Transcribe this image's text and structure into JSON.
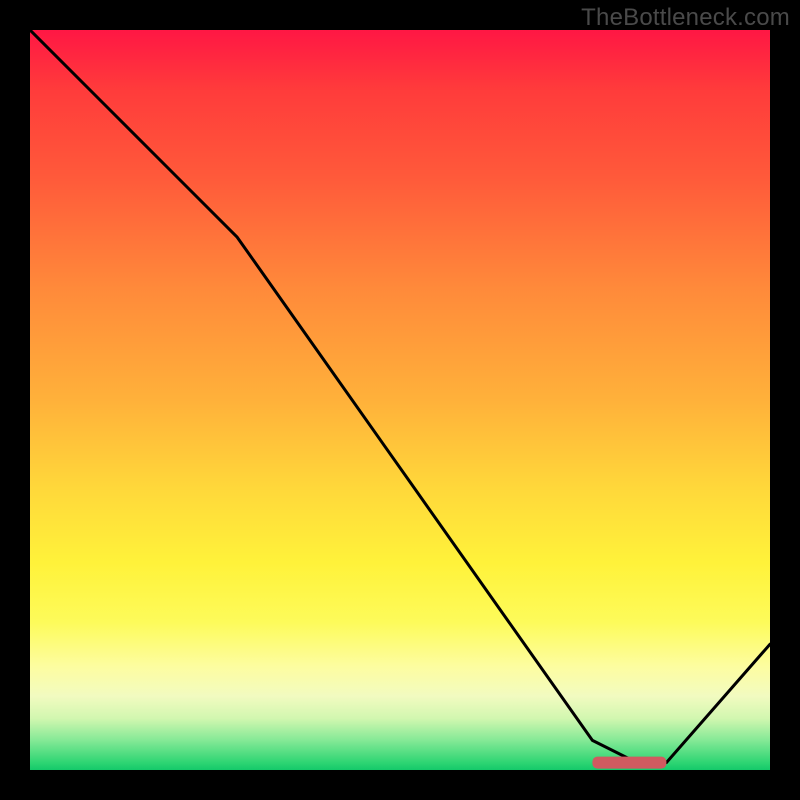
{
  "watermark": "TheBottleneck.com",
  "chart_data": {
    "type": "line",
    "title": "",
    "xlabel": "",
    "ylabel": "",
    "xlim": [
      0,
      100
    ],
    "ylim": [
      0,
      100
    ],
    "x": [
      0,
      10,
      20,
      28,
      40,
      52,
      64,
      76,
      82,
      86,
      100
    ],
    "values": [
      100,
      90,
      80,
      72,
      55,
      38,
      21,
      4,
      1,
      1,
      17
    ],
    "optimal_band": {
      "x_start": 76,
      "x_end": 86,
      "y": 1
    },
    "colors": {
      "line": "#000000",
      "band": "#d05a60",
      "gradient_top": "#ff1744",
      "gradient_bottom": "#14c96a"
    }
  }
}
